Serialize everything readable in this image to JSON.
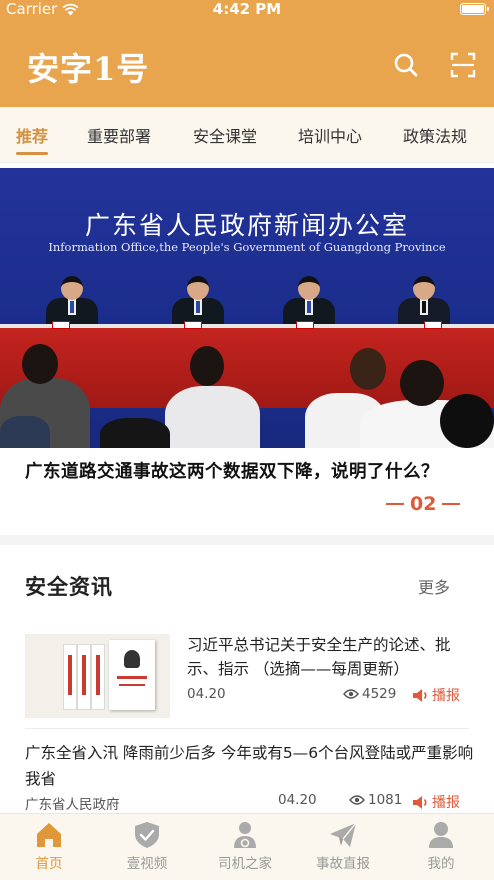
{
  "status_bar": {
    "carrier": "Carrier",
    "time": "4:42 PM"
  },
  "header": {
    "title": "安字1号",
    "icons": [
      "search-icon",
      "scan-icon"
    ]
  },
  "tabs": [
    {
      "label": "推荐",
      "active": true
    },
    {
      "label": "重要部署",
      "active": false
    },
    {
      "label": "安全课堂",
      "active": false
    },
    {
      "label": "培训中心",
      "active": false
    },
    {
      "label": "政策法规",
      "active": false
    }
  ],
  "banner": {
    "backdrop_cn": "广东省人民政府新闻办公室",
    "backdrop_en": "Information Office,the People's Government of Guangdong Province",
    "headline": "广东道路交通事故这两个数据双下降，说明了什么？",
    "page_indicator": "02"
  },
  "section": {
    "title": "安全资讯",
    "more": "更多"
  },
  "news": [
    {
      "title": "习近平总书记关于安全生产的论述、批示、指示 （选摘——每周更新）",
      "date": "04.20",
      "views": "4529",
      "play_label": "播报"
    },
    {
      "title": "广东全省入汛 降雨前少后多 今年或有5—6个台风登陆或严重影响我省",
      "source": "广东省人民政府",
      "date": "04.20",
      "views": "1081",
      "play_label": "播报"
    }
  ],
  "tabbar": [
    {
      "label": "首页",
      "icon": "home-icon",
      "active": true
    },
    {
      "label": "壹视频",
      "icon": "shield-check-icon",
      "active": false
    },
    {
      "label": "司机之家",
      "icon": "driver-icon",
      "active": false
    },
    {
      "label": "事故直报",
      "icon": "paper-plane-icon",
      "active": false
    },
    {
      "label": "我的",
      "icon": "person-icon",
      "active": false
    }
  ],
  "colors": {
    "brand": "#e8a54e",
    "accent": "#d4913f",
    "alert": "#e05a3a",
    "tab_inactive": "#999999"
  }
}
